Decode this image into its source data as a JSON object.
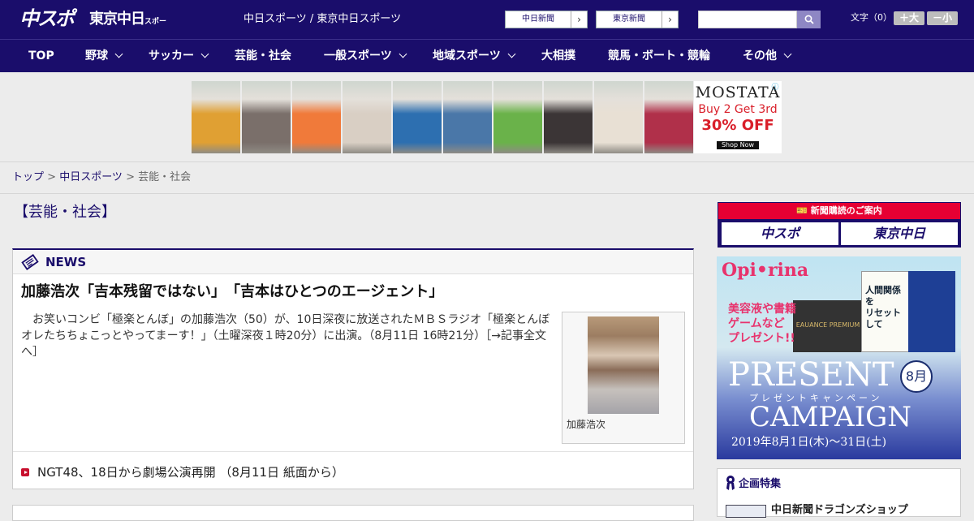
{
  "header": {
    "logo_chuspo": "中スポ",
    "logo_tokyo": "東京中日",
    "logo_tokyo_small": "スポーツ",
    "site_names": "中日スポーツ / 東京中日スポーツ",
    "ext_links": [
      {
        "label": "中日新聞",
        "arrow": "›"
      },
      {
        "label": "東京新聞",
        "arrow": "›"
      }
    ],
    "search_value": "",
    "font_size_label": "文字（0）",
    "font_larger": "＋大",
    "font_smaller": "－小"
  },
  "nav": {
    "items": [
      {
        "label": "TOP"
      },
      {
        "label": "野球"
      },
      {
        "label": "サッカー"
      },
      {
        "label": "芸能・社会"
      },
      {
        "label": "一般スポーツ"
      },
      {
        "label": "地域スポーツ"
      },
      {
        "label": "大相撲"
      },
      {
        "label": "競馬・ボート・競輪"
      },
      {
        "label": "その他"
      }
    ]
  },
  "ad": {
    "brand": "MOSTATA",
    "line1": "Buy 2 Get 3rd",
    "line2": "30% OFF",
    "shop": "Shop Now",
    "photo_colors": [
      "#e0a033",
      "#7a6f6a",
      "#f07a3a",
      "#d9cfc4",
      "#2d6fb0",
      "#4a77a8",
      "#6ab24a",
      "#3b3536",
      "#e8e0d4",
      "#b0304a"
    ]
  },
  "breadcrumb": {
    "top": "トップ",
    "sep": " > ",
    "site": "中日スポーツ",
    "current": "芸能・社会"
  },
  "page_title": "【芸能・社会】",
  "news": {
    "section_label": "NEWS",
    "headline": "加藤浩次「吉本残留ではない」　「吉本はひとつのエージェント」",
    "body": "　お笑いコンビ「極楽とんぼ」の加藤浩次（50）が、10日深夜に放送されたＭＢＳラジオ「極楽とんぼ　オレたちちょこっとやってまーす！」（土曜深夜１時20分）に出演。（8月11日 16時21分）",
    "more_link": "［→記事全文へ］",
    "photo_caption": "加藤浩次",
    "sub_link": "NGT48、18日から劇場公演再開 （8月11日 紙面から）"
  },
  "sidebar": {
    "subscribe_title": "新聞購読のご案内",
    "subscribe_logo1": "中スポ",
    "subscribe_logo2": "東京中日",
    "present": {
      "brand": "Opi•rina",
      "text": "美容液や書籍\nゲームなど\nプレゼント!!",
      "word1": "PRESENT",
      "kana": "プレゼントキャンペーン",
      "word2": "CAMPAIGN",
      "month": "8月",
      "date": "2019年8月1日(木)〜31日(土)",
      "book_text": "人間関係を\nリセットして",
      "product_text": "EAUANCE PREMIUM"
    },
    "planning_label": "企画特集",
    "planning_item": "中日新聞ドラゴンズショップ"
  }
}
